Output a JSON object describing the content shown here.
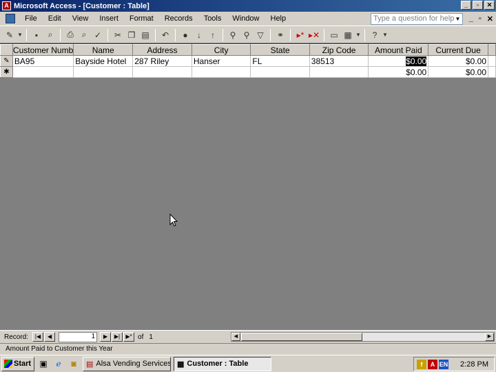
{
  "window": {
    "title": "Microsoft Access - [Customer : Table]"
  },
  "menu": {
    "items": [
      "File",
      "Edit",
      "View",
      "Insert",
      "Format",
      "Records",
      "Tools",
      "Window",
      "Help"
    ],
    "help_placeholder": "Type a question for help"
  },
  "table": {
    "columns": [
      "Customer Numb",
      "Name",
      "Address",
      "City",
      "State",
      "Zip Code",
      "Amount Paid",
      "Current Due"
    ],
    "row": {
      "customer_number": "BA95",
      "name": "Bayside Hotel",
      "address": "287 Riley",
      "city": "Hanser",
      "state": "FL",
      "zip": "38513",
      "amount_paid": "$0.00",
      "current_due": "$0.00"
    },
    "new_row": {
      "amount_paid": "$0.00",
      "current_due": "$0.00"
    }
  },
  "navigation": {
    "label": "Record:",
    "current": "1",
    "of_label": "of",
    "total": "1"
  },
  "status": "Amount Paid to Customer this Year",
  "taskbar": {
    "start": "Start",
    "tasks": [
      "Alsa Vending Services : D...",
      "Customer : Table"
    ],
    "clock": "2:28 PM",
    "tray_lang": "EN"
  }
}
